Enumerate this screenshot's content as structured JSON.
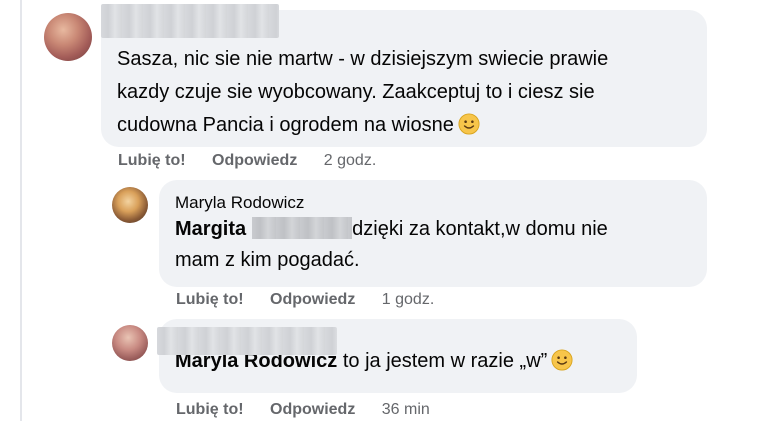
{
  "comments": [
    {
      "author": "",
      "text": "Sasza, nic sie nie martw - w dzisiejszym swiecie prawie",
      "text_line2": "kazdy czuje sie wyobcowany. Zaakceptuj to i ciesz sie",
      "text_line3": "cudowna Pancia i ogrodem na wiosne",
      "emoji": "slightly-smiling-face-icon",
      "actions": {
        "like": "Lubię to!",
        "reply": "Odpowiedz",
        "time": "2 godz."
      }
    },
    {
      "author": "Maryla Rodowicz",
      "mention": "Margita",
      "text": "dzięki za kontakt,w domu nie",
      "text_line2": "mam z kim pogadać.",
      "actions": {
        "like": "Lubię to!",
        "reply": "Odpowiedz",
        "time": "1 godz."
      }
    },
    {
      "author": "",
      "mention": "Maryla Rodowicz",
      "text": "to ja jestem w razie „w”",
      "emoji": "slightly-smiling-face-icon",
      "actions": {
        "like": "Lubię to!",
        "reply": "Odpowiedz",
        "time": "36 min"
      }
    }
  ],
  "colors": {
    "bubble": "#f0f2f5",
    "text": "#050505",
    "meta": "#65676b",
    "emoji": "#f7c54a"
  }
}
